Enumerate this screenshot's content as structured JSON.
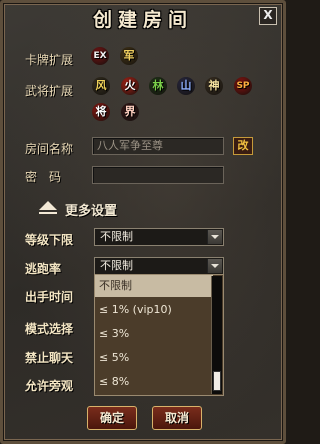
{
  "dialog": {
    "title": "创建房间",
    "close_label": "X"
  },
  "card_expansion": {
    "label": "卡牌扩展",
    "badges": [
      {
        "text": "EX",
        "color": "#f2f2f2",
        "bg": "#7a1515"
      },
      {
        "text": "军",
        "color": "#f1d060",
        "bg": "#4a3a1a"
      }
    ]
  },
  "general_expansion": {
    "label": "武将扩展",
    "badges": [
      {
        "text": "风",
        "color": "#f1d35a",
        "bg": "#3a3323"
      },
      {
        "text": "火",
        "color": "#ffffff",
        "bg": "#b42418"
      },
      {
        "text": "林",
        "color": "#7bd04a",
        "bg": "#23381b"
      },
      {
        "text": "山",
        "color": "#8fb0ff",
        "bg": "#2a2a44"
      },
      {
        "text": "神",
        "color": "#f6e3a0",
        "bg": "#3f3426"
      },
      {
        "text": "SP",
        "color": "#ffb040",
        "bg": "#8a1410"
      },
      {
        "text": "将",
        "color": "#ffffff",
        "bg": "#9a1a14"
      },
      {
        "text": "界",
        "color": "#ffd0c0",
        "bg": "#3a1a1a"
      }
    ]
  },
  "room_name": {
    "label": "房间名称",
    "value": "八人军争至尊",
    "rename_label": "改"
  },
  "password": {
    "label": "密　码",
    "value": ""
  },
  "more_settings": {
    "label": "更多设置"
  },
  "level_limit": {
    "label": "等级下限",
    "value": "不限制"
  },
  "escape_rate": {
    "label": "逃跑率",
    "value": "不限制"
  },
  "hidden_rows": {
    "play_time": "出手时间",
    "mode_select": "模式选择",
    "no_chat": "禁止聊天",
    "allow_spectate": "允许旁观"
  },
  "dropdown": {
    "options": [
      "不限制",
      "≤ 1% (vip10)",
      "≤ 3%",
      "≤ 5%",
      "≤ 8%"
    ],
    "highlighted_index": 0
  },
  "buttons": {
    "confirm": "确定",
    "cancel": "取消"
  }
}
